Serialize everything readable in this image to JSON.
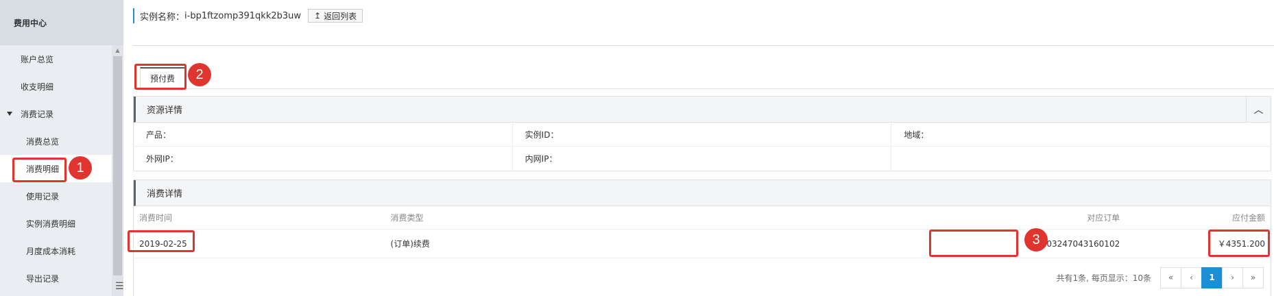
{
  "sidebar": {
    "title": "费用中心",
    "items": [
      {
        "label": "账户总览"
      },
      {
        "label": "收支明细"
      },
      {
        "label": "消费记录"
      },
      {
        "label": "消费总览"
      },
      {
        "label": "消费明细"
      },
      {
        "label": "使用记录"
      },
      {
        "label": "实例消费明细"
      },
      {
        "label": "月度成本消耗"
      },
      {
        "label": "导出记录"
      }
    ]
  },
  "header": {
    "instance_label": "实例名称：",
    "instance_value": "i-bp1ftzomp391qkk2b3uw",
    "back_label": "返回列表"
  },
  "tabs": [
    {
      "label": "预付费"
    }
  ],
  "resource": {
    "title": "资源详情",
    "fields": [
      {
        "label": "产品："
      },
      {
        "label": "实例ID："
      },
      {
        "label": "地域："
      },
      {
        "label": "外网IP："
      },
      {
        "label": "内网IP："
      }
    ]
  },
  "consumption": {
    "title": "消费详情",
    "columns": [
      "消费时间",
      "消费类型",
      "对应订单",
      "应付金额"
    ],
    "rows": [
      {
        "time": "2019-02-25",
        "type": "(订单)续费",
        "order": "203247043160102",
        "amount": "￥4351.200"
      }
    ]
  },
  "pagination": {
    "summary": "共有1条, 每页显示：10条",
    "buttons": [
      "«",
      "‹",
      "1",
      "›",
      "»"
    ],
    "current": "1"
  },
  "annotations": [
    "1",
    "2",
    "3"
  ],
  "colors": {
    "accent": "#1b8fd6",
    "highlight": "#e0342f",
    "sidebar_bg": "#eaedf1"
  }
}
